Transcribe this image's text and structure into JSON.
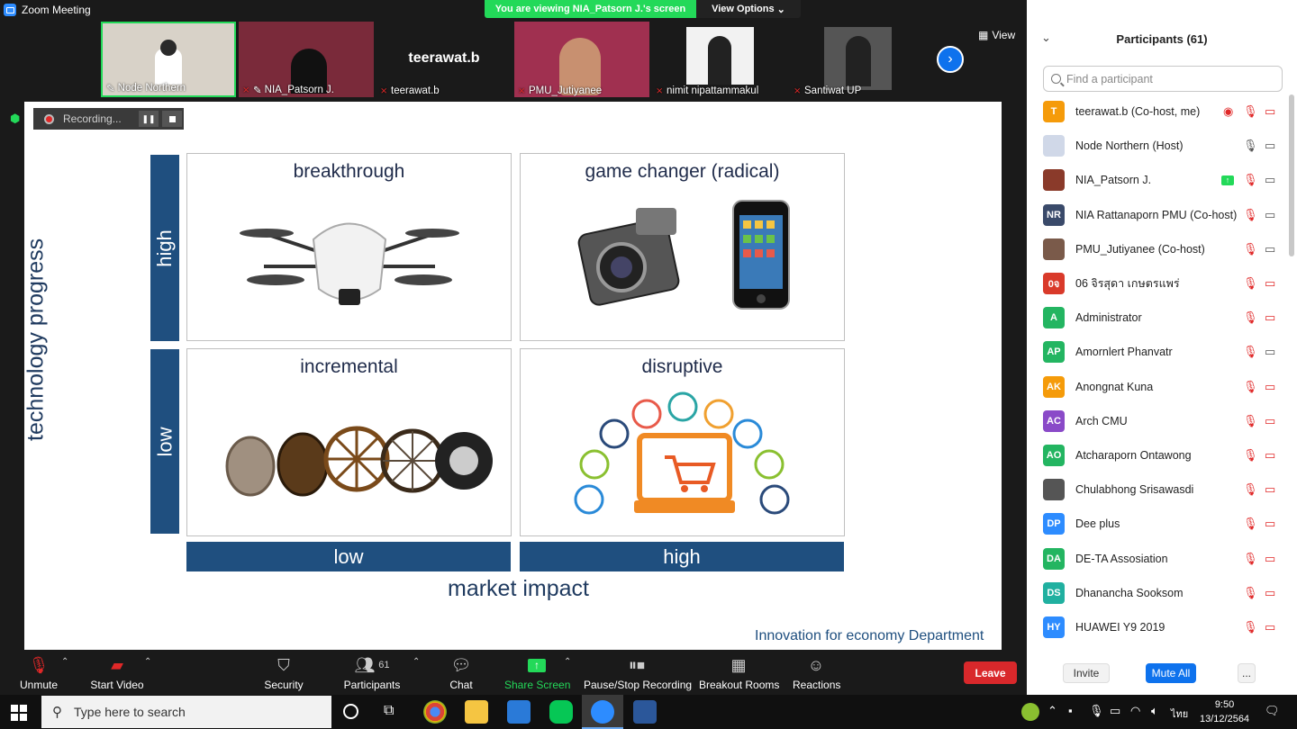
{
  "window": {
    "title": "Zoom Meeting"
  },
  "banner": {
    "viewing": "You are viewing NIA_Patsorn J.'s screen",
    "view_options": "View Options"
  },
  "thumbnails": [
    {
      "name": "Node Northern",
      "bg": "#d8d2c8"
    },
    {
      "name": "NIA_Patsorn J.",
      "bg": "#7a2a3a"
    },
    {
      "name": "teerawat.b",
      "big": "teerawat.b",
      "bg": "#1a1a1a"
    },
    {
      "name": "PMU_Jutiyanee",
      "bg": "#a03050"
    },
    {
      "name": "nimit nipattammakul",
      "bg": "#e8e8e8"
    },
    {
      "name": "Santiwat UP",
      "bg": "#2a2a2a"
    }
  ],
  "view_label": "View",
  "recording": {
    "label": "Recording..."
  },
  "slide": {
    "quadrants": {
      "tl": "breakthrough",
      "tr": "game changer (radical)",
      "bl": "incremental",
      "br": "disruptive"
    },
    "y_high": "high",
    "y_low": "low",
    "x_low": "low",
    "x_high": "high",
    "y_axis": "technology progress",
    "x_axis": "market impact",
    "footer": "Innovation for economy Department"
  },
  "participants_panel": {
    "title": "Participants (61)",
    "search_placeholder": "Find a participant",
    "people": [
      {
        "initials": "T",
        "color": "#f59b0a",
        "name": "teerawat.b (Co-host, me)"
      },
      {
        "initials": "",
        "color": "#d0d8e8",
        "name": "Node Northern (Host)"
      },
      {
        "initials": "",
        "color": "#8a3a2a",
        "name": "NIA_Patsorn J."
      },
      {
        "initials": "NR",
        "color": "#3a4a6a",
        "name": "NIA Rattanaporn PMU (Co-host)"
      },
      {
        "initials": "",
        "color": "#7a5a4a",
        "name": "PMU_Jutiyanee (Co-host)"
      },
      {
        "initials": "0จ",
        "color": "#d93a2a",
        "name": "06  จิรสุดา เกษตรแพร่"
      },
      {
        "initials": "A",
        "color": "#23b561",
        "name": "Administrator"
      },
      {
        "initials": "AP",
        "color": "#23b561",
        "name": "Amornlert Phanvatr"
      },
      {
        "initials": "AK",
        "color": "#f59b0a",
        "name": "Anongnat Kuna"
      },
      {
        "initials": "AC",
        "color": "#8a4ac8",
        "name": "Arch CMU"
      },
      {
        "initials": "AO",
        "color": "#23b561",
        "name": "Atcharaporn Ontawong"
      },
      {
        "initials": "",
        "color": "#555555",
        "name": "Chulabhong Srisawasdi"
      },
      {
        "initials": "DP",
        "color": "#2d8cff",
        "name": "Dee plus"
      },
      {
        "initials": "DA",
        "color": "#23b561",
        "name": "DE-TA Assosiation"
      },
      {
        "initials": "DS",
        "color": "#20b0a0",
        "name": "Dhanancha Sooksom"
      },
      {
        "initials": "HY",
        "color": "#2d8cff",
        "name": "HUAWEI Y9 2019"
      }
    ],
    "invite": "Invite",
    "mute_all": "Mute All",
    "more": "..."
  },
  "toolbar": {
    "unmute": "Unmute",
    "start_video": "Start Video",
    "security": "Security",
    "participants": "Participants",
    "participants_count": "61",
    "chat": "Chat",
    "share_screen": "Share Screen",
    "pause_stop": "Pause/Stop Recording",
    "breakout": "Breakout Rooms",
    "reactions": "Reactions",
    "leave": "Leave"
  },
  "taskbar": {
    "search": "Type here to search",
    "time": "9:50",
    "date": "13/12/2564",
    "lang": "ไทย"
  }
}
